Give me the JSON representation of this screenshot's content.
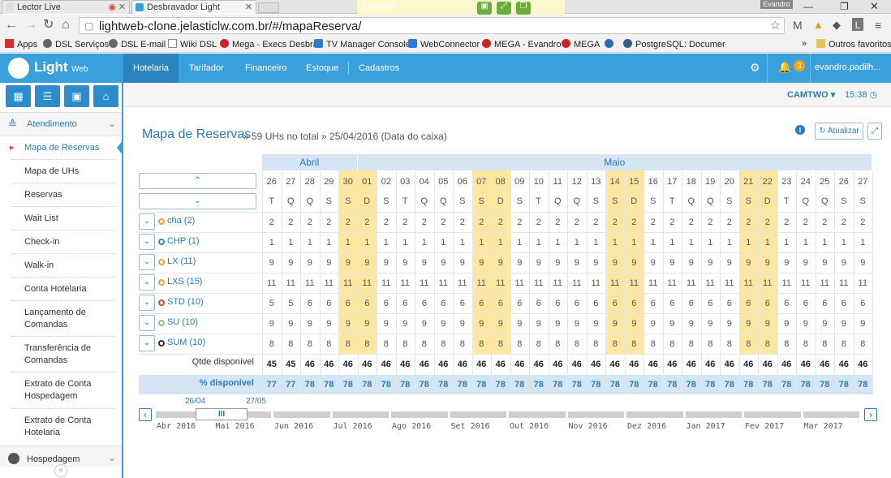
{
  "browser": {
    "tabs": [
      {
        "title": "Lector Live",
        "active": false
      },
      {
        "title": "Desbravador Light",
        "active": true
      }
    ],
    "new_tab_user": "Evandro",
    "window_user": "Evandro",
    "url": "lightweb-clone.jelasticlw.com.br/#/mapaReserva/",
    "bookmarks": [
      "Apps",
      "DSL Serviços",
      "DSL E-mail",
      "Wiki DSL",
      "Mega - Execs Desbra",
      "TV Manager Console",
      "WebConnector",
      "MEGA - Evandro",
      "MEGA",
      "PostgreSQL: Documer"
    ],
    "bookmarks_more": "»",
    "other_favorites": "Outros favoritos"
  },
  "app": {
    "logo_main": "Light",
    "logo_sub": "Web",
    "nav": [
      "Hotelaria",
      "Tarifador",
      "Financeiro",
      "Estoque",
      "Cadastros"
    ],
    "notification_count": "3",
    "user": "evandro.padilh...",
    "hotel": "CAMTWO",
    "time": "15:38"
  },
  "sidebar": {
    "section": "Atendimento",
    "items": [
      "Mapa de Reservas",
      "Mapa de UHs",
      "Reservas",
      "Wait List",
      "Check-in",
      "Walk-in",
      "Conta Hotelaria",
      "Lançamento de Comandas",
      "Transferência de Comandas",
      "Extrato de Conta Hospedagem",
      "Extrato de Conta Hotelaria"
    ],
    "section2": "Hospedagem",
    "collapse": "«"
  },
  "page": {
    "title": "Mapa de Reservas",
    "subtitle": "» 59 UHs no total » 25/04/2016 (Data do caixa)",
    "refresh_label": "Atualizar",
    "nav_up": "⌃",
    "nav_down": "⌄"
  },
  "calendar": {
    "months": [
      {
        "name": "Abril",
        "span": 5
      },
      {
        "name": "Maio",
        "span": 27
      }
    ],
    "days": [
      "26",
      "27",
      "28",
      "29",
      "30",
      "01",
      "02",
      "03",
      "04",
      "05",
      "06",
      "07",
      "08",
      "09",
      "10",
      "11",
      "12",
      "13",
      "14",
      "15",
      "16",
      "17",
      "18",
      "19",
      "20",
      "21",
      "22",
      "23",
      "24",
      "25",
      "26",
      "27"
    ],
    "weekdays": [
      "T",
      "Q",
      "Q",
      "S",
      "S",
      "D",
      "S",
      "T",
      "Q",
      "Q",
      "S",
      "S",
      "D",
      "S",
      "T",
      "Q",
      "Q",
      "S",
      "S",
      "D",
      "S",
      "T",
      "Q",
      "Q",
      "S",
      "S",
      "D",
      "T",
      "Q",
      "Q",
      "S",
      "S"
    ],
    "weekend_cols": [
      4,
      5,
      11,
      12,
      18,
      19,
      25,
      26
    ],
    "room_types": [
      {
        "label": "cha (2)",
        "color": "#e8a33a",
        "values": [
          "2",
          "2",
          "2",
          "2",
          "2",
          "2",
          "2",
          "2",
          "2",
          "2",
          "2",
          "2",
          "2",
          "2",
          "2",
          "2",
          "2",
          "2",
          "2",
          "2",
          "2",
          "2",
          "2",
          "2",
          "2",
          "2",
          "2",
          "2",
          "2",
          "2",
          "2",
          "2"
        ]
      },
      {
        "label": "CHP (1)",
        "color": "#3a84c9",
        "values": [
          "1",
          "1",
          "1",
          "1",
          "1",
          "1",
          "1",
          "1",
          "1",
          "1",
          "1",
          "1",
          "1",
          "1",
          "1",
          "1",
          "1",
          "1",
          "1",
          "1",
          "1",
          "1",
          "1",
          "1",
          "1",
          "1",
          "1",
          "1",
          "1",
          "1",
          "1",
          "1"
        ]
      },
      {
        "label": "LX (11)",
        "color": "#e8a33a",
        "values": [
          "9",
          "9",
          "9",
          "9",
          "9",
          "9",
          "9",
          "9",
          "9",
          "9",
          "9",
          "9",
          "9",
          "9",
          "9",
          "9",
          "9",
          "9",
          "9",
          "9",
          "9",
          "9",
          "9",
          "9",
          "9",
          "9",
          "9",
          "9",
          "9",
          "9",
          "9",
          "9"
        ]
      },
      {
        "label": "LXS (15)",
        "color": "#e8a33a",
        "values": [
          "11",
          "11",
          "11",
          "11",
          "11",
          "11",
          "11",
          "11",
          "11",
          "11",
          "11",
          "11",
          "11",
          "11",
          "11",
          "11",
          "11",
          "11",
          "11",
          "11",
          "11",
          "11",
          "11",
          "11",
          "11",
          "11",
          "11",
          "11",
          "11",
          "11",
          "11",
          "11"
        ]
      },
      {
        "label": "STD (10)",
        "color": "#d9443c",
        "values": [
          "5",
          "5",
          "6",
          "6",
          "6",
          "6",
          "6",
          "6",
          "6",
          "6",
          "6",
          "6",
          "6",
          "6",
          "6",
          "6",
          "6",
          "6",
          "6",
          "6",
          "6",
          "6",
          "6",
          "6",
          "6",
          "6",
          "6",
          "6",
          "6",
          "6",
          "6",
          "6"
        ]
      },
      {
        "label": "SU (10)",
        "color": "#aaaaaa",
        "values": [
          "9",
          "9",
          "9",
          "9",
          "9",
          "9",
          "9",
          "9",
          "9",
          "9",
          "9",
          "9",
          "9",
          "9",
          "9",
          "9",
          "9",
          "9",
          "9",
          "9",
          "9",
          "9",
          "9",
          "9",
          "9",
          "9",
          "9",
          "9",
          "9",
          "9",
          "9",
          "9"
        ]
      },
      {
        "label": "SUM (10)",
        "color": "#333333",
        "values": [
          "8",
          "8",
          "8",
          "8",
          "8",
          "8",
          "8",
          "8",
          "8",
          "8",
          "8",
          "8",
          "8",
          "8",
          "8",
          "8",
          "8",
          "8",
          "8",
          "8",
          "8",
          "8",
          "8",
          "8",
          "8",
          "8",
          "8",
          "8",
          "8",
          "8",
          "8",
          "8"
        ]
      }
    ],
    "available_label": "Qtde disponível",
    "available": [
      "45",
      "45",
      "46",
      "46",
      "46",
      "46",
      "46",
      "46",
      "46",
      "46",
      "46",
      "46",
      "46",
      "46",
      "46",
      "46",
      "46",
      "46",
      "46",
      "46",
      "46",
      "46",
      "46",
      "46",
      "46",
      "46",
      "46",
      "46",
      "46",
      "46",
      "46",
      "46"
    ],
    "percent_label": "% disponível",
    "percent": [
      "77",
      "77",
      "78",
      "78",
      "78",
      "78",
      "78",
      "78",
      "78",
      "78",
      "78",
      "78",
      "78",
      "78",
      "78",
      "78",
      "78",
      "78",
      "78",
      "78",
      "78",
      "78",
      "78",
      "78",
      "78",
      "78",
      "78",
      "78",
      "78",
      "78",
      "78",
      "78"
    ]
  },
  "timeline": {
    "range_start": "26/04",
    "range_end": "27/05",
    "months": [
      "Abr 2016",
      "Mai 2016",
      "Jun 2016",
      "Jul 2016",
      "Ago 2016",
      "Set 2016",
      "Out 2016",
      "Nov 2016",
      "Dez 2016",
      "Jan 2017",
      "Fev 2017",
      "Mar 2017"
    ],
    "handle": "III"
  }
}
